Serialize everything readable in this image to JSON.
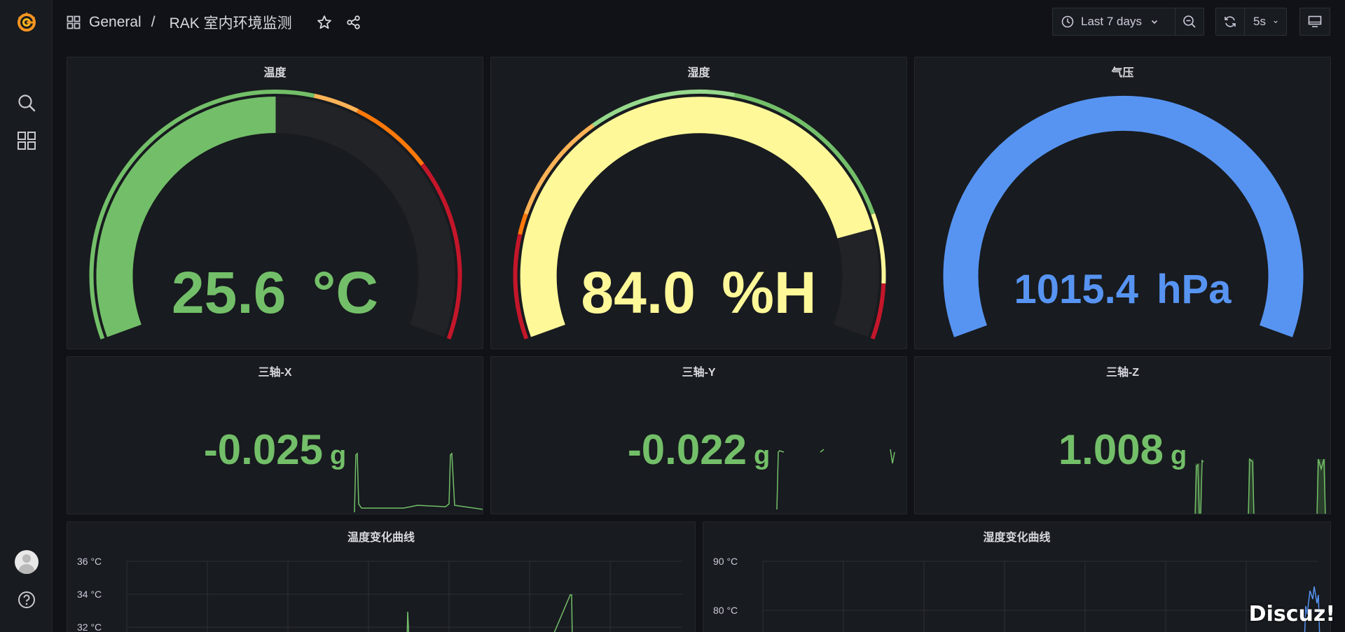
{
  "breadcrumb": {
    "folder": "General",
    "separator": "/",
    "title": "RAK 室内环境监测"
  },
  "toolbar": {
    "time_range": "Last 7 days",
    "refresh_interval": "5s"
  },
  "colors": {
    "green": "#73bf69",
    "yellow": "#fff899",
    "blue": "#5794f2",
    "red": "#c4162a",
    "orange": "#ff780a",
    "light_orange": "#ffb357"
  },
  "gauges": [
    {
      "title": "温度",
      "value": "25.6",
      "unit": "°C",
      "fraction": 0.5
    },
    {
      "title": "湿度",
      "value": "84.0",
      "unit": "%H",
      "fraction": 0.84
    },
    {
      "title": "气压",
      "value": "1015.4",
      "unit": "hPa",
      "fraction": 1.0
    }
  ],
  "stats": [
    {
      "title": "三轴-X",
      "value": "-0.025",
      "unit": "g"
    },
    {
      "title": "三轴-Y",
      "value": "-0.022",
      "unit": "g"
    },
    {
      "title": "三轴-Z",
      "value": "1.008",
      "unit": "g"
    }
  ],
  "charts": [
    {
      "title": "温度变化曲线",
      "y_ticks": [
        "36 °C",
        "34 °C",
        "32 °C"
      ]
    },
    {
      "title": "湿度变化曲线",
      "y_ticks": [
        "90 °C",
        "80 °C"
      ]
    }
  ],
  "watermark": "Discuz!"
}
